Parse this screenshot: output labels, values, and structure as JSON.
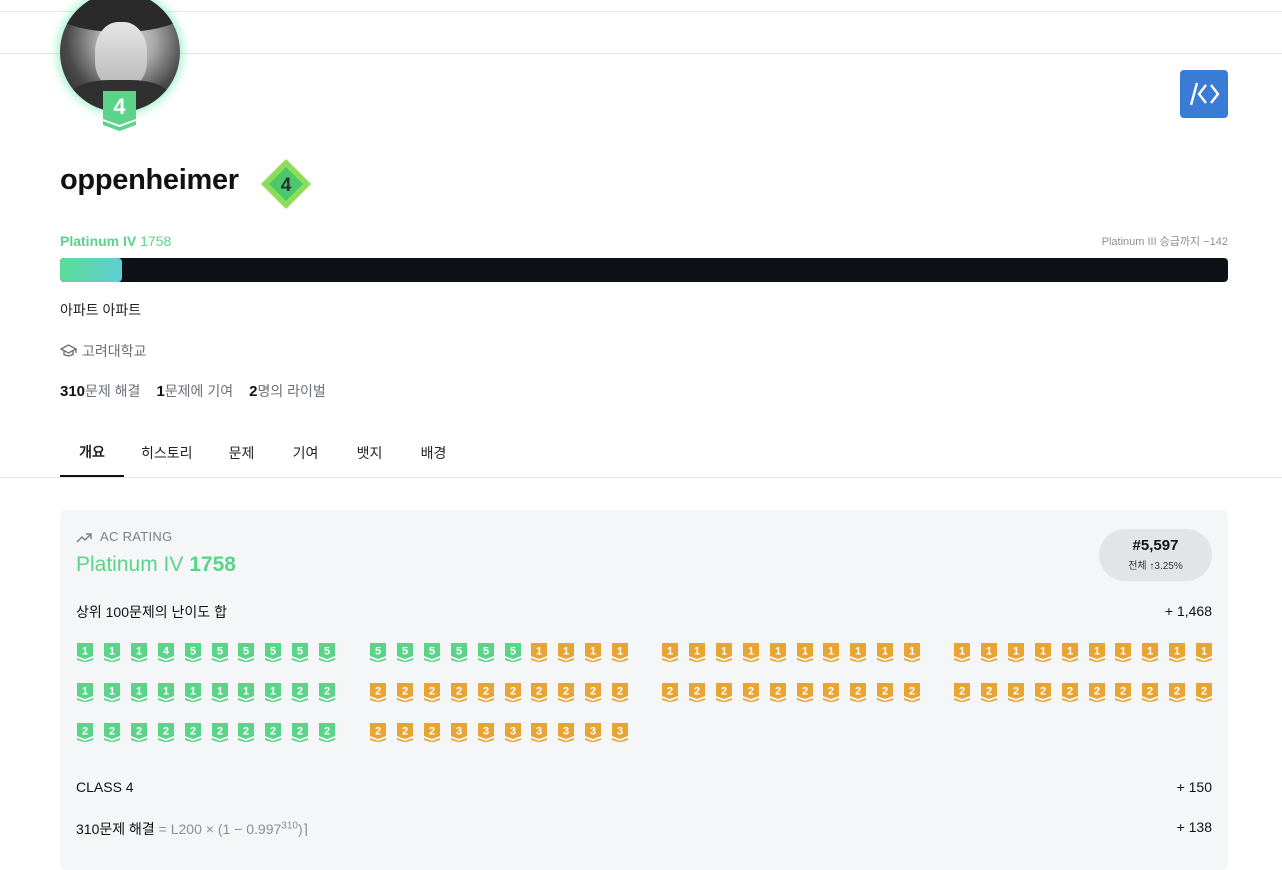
{
  "profile": {
    "username": "oppenheimer",
    "avatar_badge_level": "4",
    "tier_level": "4",
    "tier_name": "Platinum IV",
    "rating": "1758",
    "next_tier_text": "Platinum III 승급까지 −142",
    "progress_fraction": 0.053,
    "bio": "아파트 아파트",
    "school": "고려대학교",
    "stats": {
      "solved_count": "310",
      "solved_label": "문제 해결",
      "contrib_count": "1",
      "contrib_label": "문제에 기여",
      "rival_count": "2",
      "rival_label": "명의 라이벌"
    }
  },
  "tabs": [
    "개요",
    "히스토리",
    "문제",
    "기여",
    "뱃지",
    "배경"
  ],
  "active_tab": "개요",
  "ac_rating": {
    "header": "AC RATING",
    "tier_name": "Platinum IV",
    "rating": "1758",
    "rank": "#5,597",
    "rank_detail": "전체 ↑3.25%",
    "top100_label": "상위 100문제의 난이도 합",
    "top100_value": "+ 1,468",
    "badge_groups": [
      [
        "P1",
        "P1",
        "P1",
        "P4",
        "P5",
        "P5",
        "P5",
        "P5",
        "P5",
        "P5",
        "P1",
        "P1",
        "P1",
        "P1",
        "P1",
        "P1",
        "P1",
        "P1",
        "P2",
        "P2",
        "P2",
        "P2",
        "P2",
        "P2",
        "P2",
        "P2",
        "P2",
        "P2",
        "P2",
        "P2"
      ],
      [
        "P5",
        "P5",
        "P5",
        "P5",
        "P5",
        "P5",
        "G1",
        "G1",
        "G1",
        "G1",
        "G2",
        "G2",
        "G2",
        "G2",
        "G2",
        "G2",
        "G2",
        "G2",
        "G2",
        "G2",
        "G2",
        "G2",
        "G2",
        "G3",
        "G3",
        "G3",
        "G3",
        "G3",
        "G3",
        "G3"
      ],
      [
        "G1",
        "G1",
        "G1",
        "G1",
        "G1",
        "G1",
        "G1",
        "G1",
        "G1",
        "G1",
        "G2",
        "G2",
        "G2",
        "G2",
        "G2",
        "G2",
        "G2",
        "G2",
        "G2",
        "G2"
      ],
      [
        "G1",
        "G1",
        "G1",
        "G1",
        "G1",
        "G1",
        "G1",
        "G1",
        "G1",
        "G1",
        "G2",
        "G2",
        "G2",
        "G2",
        "G2",
        "G2",
        "G2",
        "G2",
        "G2",
        "G2"
      ]
    ],
    "class_label": "CLASS 4",
    "class_value": "+ 150",
    "solved_label": "310문제 해결",
    "solved_formula_prefix": " = L200 × (1 − 0.997",
    "solved_formula_exp": "310",
    "solved_formula_suffix": ")⌉",
    "solved_value": "+ 138"
  },
  "colors": {
    "platinum": "#5bd48a",
    "gold": "#e8a534",
    "accent_blue": "#3a7bd5",
    "bar_bg": "#0e1117"
  }
}
